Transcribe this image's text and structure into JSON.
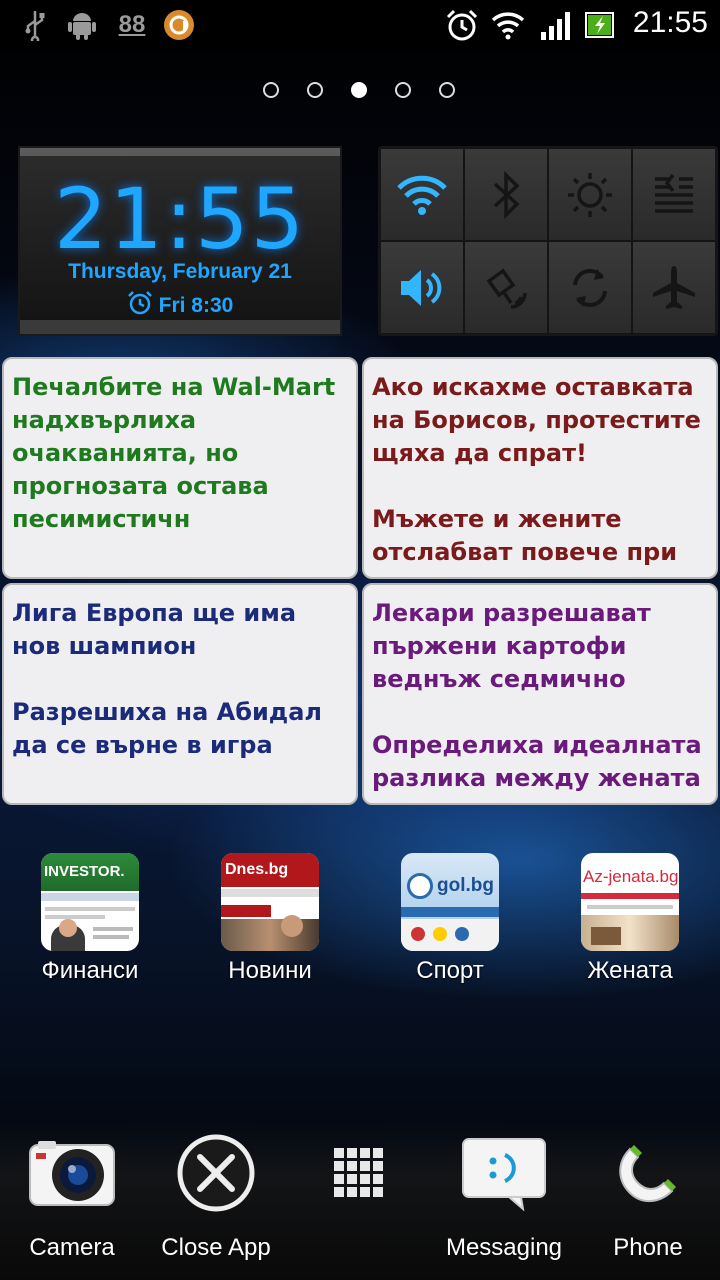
{
  "status_bar": {
    "time": "21:55",
    "notification_badge": "88",
    "icons": [
      "usb-icon",
      "android-debug-icon",
      "notification-count-icon",
      "app-notification-icon",
      "alarm-icon",
      "wifi-icon",
      "signal-icon",
      "battery-charging-icon"
    ]
  },
  "home_pages": {
    "count": 5,
    "active": 3
  },
  "clock_widget": {
    "time": "21:55",
    "date": "Thursday, February 21",
    "alarm": "Fri 8:30",
    "accent_color": "#1fa6ff"
  },
  "power_control": {
    "toggles": [
      {
        "name": "wifi",
        "active": true
      },
      {
        "name": "bluetooth",
        "active": false
      },
      {
        "name": "brightness",
        "active": false
      },
      {
        "name": "data-sync",
        "active": false
      },
      {
        "name": "sound",
        "active": true
      },
      {
        "name": "gps",
        "active": false
      },
      {
        "name": "auto-rotate",
        "active": false
      },
      {
        "name": "airplane-mode",
        "active": false
      }
    ],
    "active_color": "#33b5ff"
  },
  "news": [
    {
      "color": "#1f7a1f",
      "items": [
        "Печалбите на Wal-Mart надхвърлиха очакванията, но прогнозата остава песимистичн"
      ]
    },
    {
      "color": "#7a1a1a",
      "items": [
        "Ако искахме оставката на Борисов, протестите щяха да спрат!",
        "Мъжете и жените отслабват повече при"
      ]
    },
    {
      "color": "#1c2a7a",
      "items": [
        "Лига Европа ще има нов шампион",
        "Разрешиха на Абидал да се върне в игра"
      ]
    },
    {
      "color": "#6a1a7a",
      "items": [
        "Лекари разрешават пържени картофи веднъж седмично",
        "Определиха идеалната разлика между жената и"
      ]
    }
  ],
  "apps": [
    {
      "label": "Финанси",
      "thumb_text": "INVESTOR."
    },
    {
      "label": "Новини",
      "thumb_text": "Dnes.bg"
    },
    {
      "label": "Спорт",
      "thumb_text": "gol.bg"
    },
    {
      "label": "Жената",
      "thumb_text": "Az-jenata.bg"
    }
  ],
  "dock": [
    {
      "label": "Camera"
    },
    {
      "label": "Close App"
    },
    {
      "label": ""
    },
    {
      "label": "Messaging"
    },
    {
      "label": "Phone"
    }
  ]
}
